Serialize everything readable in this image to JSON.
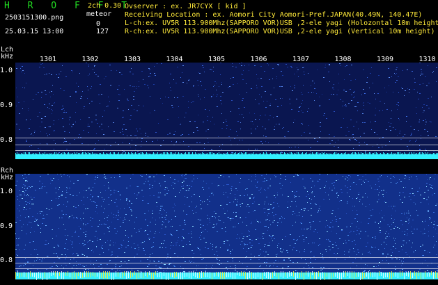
{
  "header": {
    "title": "H R O F F T",
    "version": "2ch 0.30",
    "meteor_label": "meteor",
    "meteor_l": "0",
    "meteor_r": "127",
    "filename": "2503151300.png",
    "datetime": "25.03.15 13:00",
    "observer": "Ovserver          : ex. JR7CYX [ kid ]",
    "location": "Receiving Location : ex. Aomori City Aomori-Pref.JAPAN(40.49N, 140.47E)",
    "lch_info": "L-ch:ex. UV5R 113.900Mhz(SAPPORO VOR)USB ,2-ele yagi (Holozontal 10m height)",
    "rch_info": "R-ch:ex. UV5R 113.900Mhz(SAPPORO VOR)USB ,2-ele yagi (Vertical 10m height)"
  },
  "axis": {
    "lch_label": "Lch",
    "unit": "kHz",
    "rch_label": "Rch",
    "time_ticks": [
      "1301",
      "1302",
      "1303",
      "1304",
      "1305",
      "1306",
      "1307",
      "1308",
      "1309",
      "1310"
    ],
    "lch_freq_ticks": [
      "1.0",
      "0.9",
      "0.8"
    ],
    "rch_freq_ticks": [
      "1.0",
      "0.9",
      "0.8"
    ]
  },
  "colors": {
    "background": "#000000",
    "lch_noise": "#1a3aa0",
    "rch_noise": "#2a55c8",
    "carrier": "#33f0ff",
    "title": "#22dd22",
    "hot": "#ffea3a"
  }
}
